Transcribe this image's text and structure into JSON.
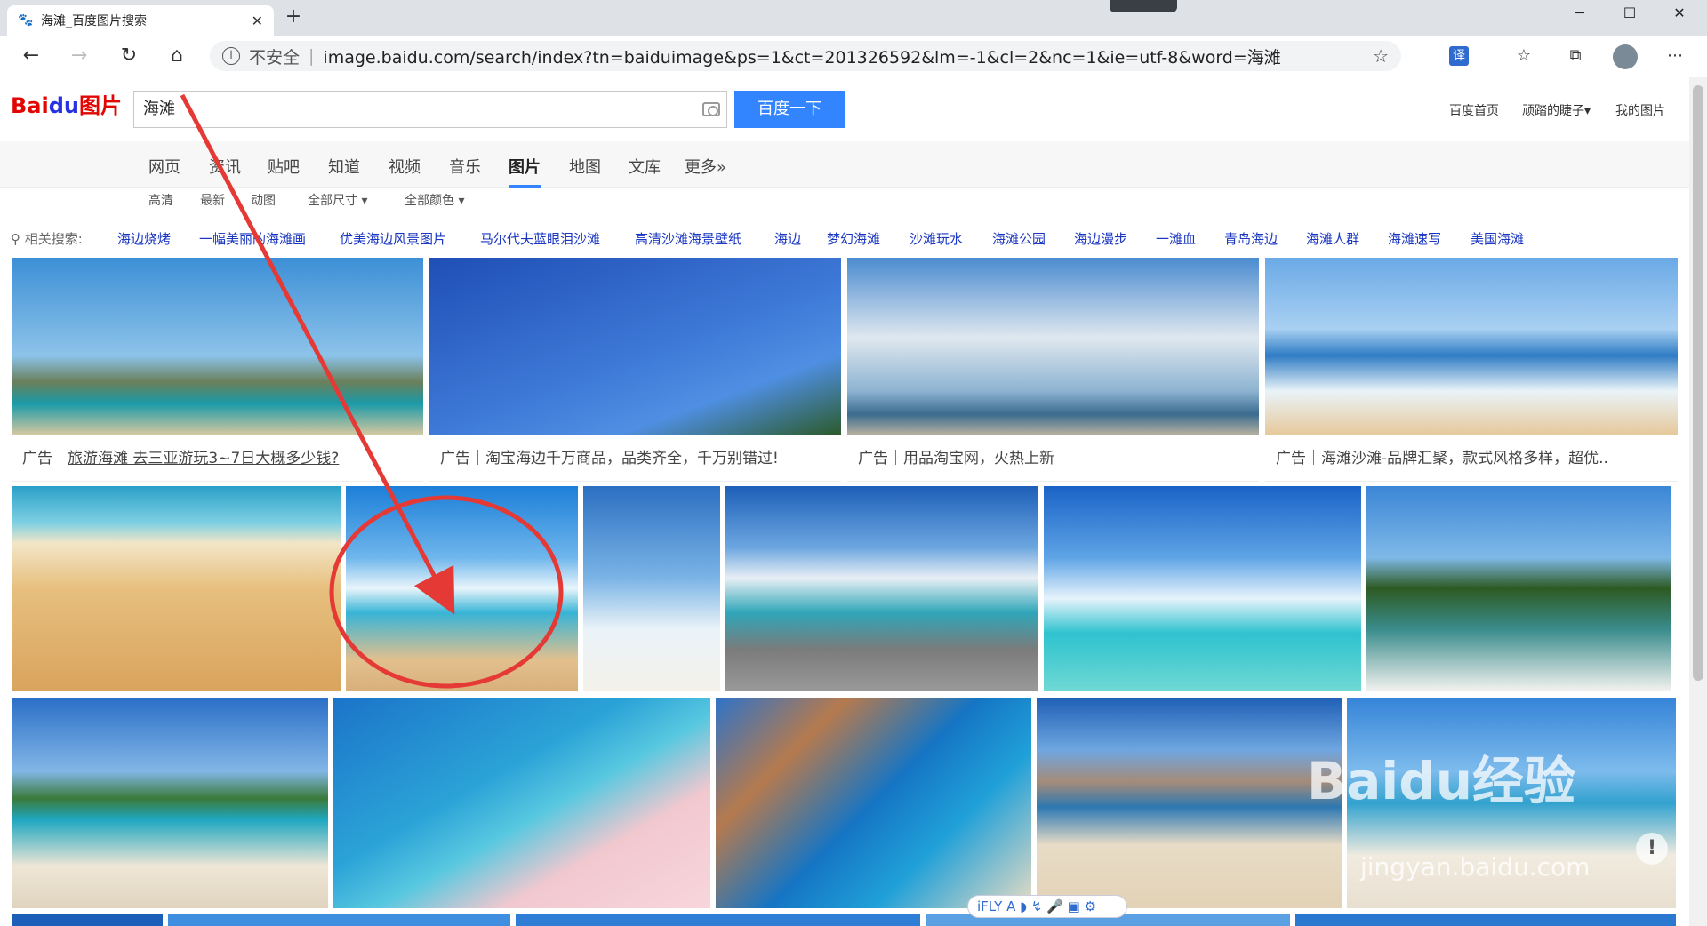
{
  "browser": {
    "tab_title": "海滩_百度图片搜索",
    "tab_close": "✕",
    "new_tab": "+",
    "address_insecure": "不安全",
    "address_sep": "|",
    "address_url": "image.baidu.com/search/index?tn=baiduimage&ps=1&ct=201326592&lm=-1&cl=2&nc=1&ie=utf-8&word=海滩",
    "minimize": "─",
    "maximize": "☐",
    "close": "✕"
  },
  "baidu": {
    "logo_bai": "Bai",
    "logo_paw": "du",
    "logo_pic": "图片",
    "search_value": "海滩",
    "search_button": "百度一下",
    "top_links": [
      "百度首页",
      "顽踏的睫子▾",
      "我的图片"
    ]
  },
  "nav": [
    "网页",
    "资讯",
    "贴吧",
    "知道",
    "视频",
    "音乐",
    "图片",
    "地图",
    "文库",
    "更多»"
  ],
  "filters": [
    "高清",
    "最新",
    "动图",
    "全部尺寸 ▾",
    "全部颜色 ▾"
  ],
  "related_label": "相关搜索:",
  "related": [
    "海边烧烤",
    "一幅美丽的海滩画",
    "优美海边风景图片",
    "马尔代夫蓝眼泪沙滩",
    "高清沙滩海景壁纸",
    "海边",
    "梦幻海滩",
    "沙滩玩水",
    "海滩公园",
    "海边漫步",
    "一滩血",
    "青岛海边",
    "海滩人群",
    "海滩速写",
    "美国海滩"
  ],
  "ads": [
    {
      "prefix": "广告｜",
      "text": "旅游海滩 去三亚游玩3~7日大概多少钱?"
    },
    {
      "prefix": "广告｜",
      "text": "淘宝海边千万商品，品类齐全，千万别错过!"
    },
    {
      "prefix": "广告｜",
      "text": "用品淘宝网，火热上新"
    },
    {
      "prefix": "广告｜",
      "text": "海滩沙滩-品牌汇聚，款式风格多样，超优.."
    }
  ],
  "ifly": "iFLY A ◗ ↯ 🎤 ▣ ⚙",
  "watermark": "Baidu经验",
  "watermark_url": "jingyan.baidu.com",
  "excl": "!",
  "colors": {
    "accent": "#3385ff",
    "link": "#1a36c2",
    "annotation": "#e53935"
  }
}
